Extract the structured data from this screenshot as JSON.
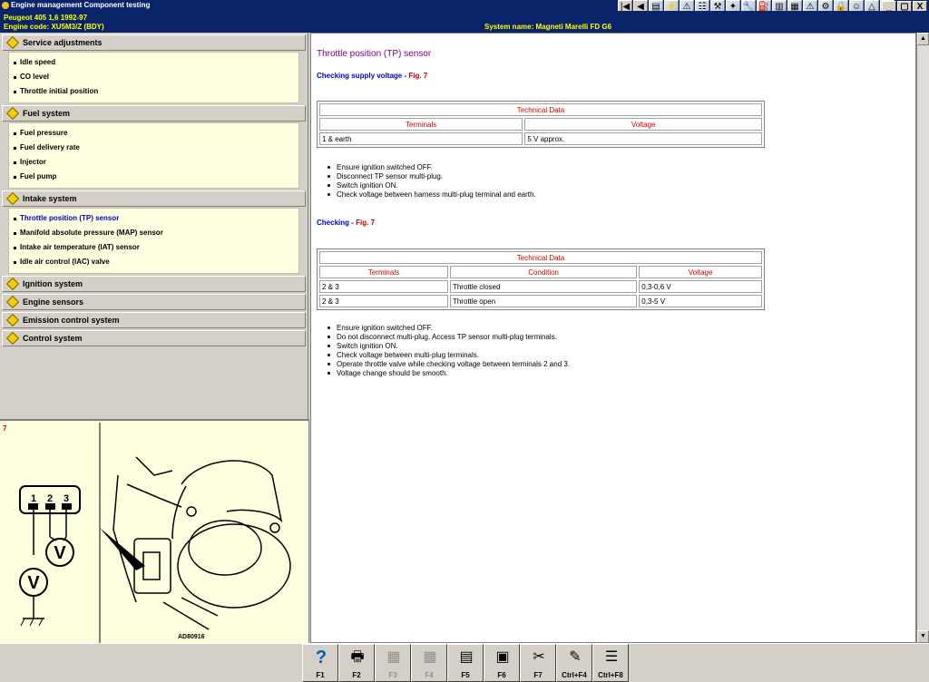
{
  "window": {
    "title": "Engine management Component testing"
  },
  "toolbar": {
    "buttons": [
      "first-icon",
      "prev-icon",
      "data-icon",
      "wiring-icon",
      "fault-icon",
      "service-icon",
      "tools-icon",
      "spark-icon",
      "wrench-icon",
      "oil-icon",
      "book-icon",
      "chart-icon",
      "warning-icon",
      "gear-icon",
      "lock-icon",
      "user-icon",
      "triangle-icon",
      "help-icon"
    ],
    "window_buttons": [
      "_",
      "▢",
      "X"
    ]
  },
  "vehicle": {
    "line1": "Peugeot   405 1,6   1992-97",
    "line2": "Engine code: XU5M3/Z (BDY)",
    "system": "System name: Magneti Marelli FD G6"
  },
  "nav": {
    "sections": [
      {
        "label": "Service adjustments",
        "items": [
          "Idle speed",
          "CO level",
          "Throttle initial position"
        ]
      },
      {
        "label": "Fuel system",
        "items": [
          "Fuel pressure",
          "Fuel delivery rate",
          "Injector",
          "Fuel pump"
        ]
      },
      {
        "label": "Intake system",
        "items": [
          "Throttle position (TP) sensor",
          "Manifold absolute pressure (MAP) sensor",
          "Intake air temperature (IAT) sensor",
          "Idle air control (IAC) valve"
        ]
      },
      {
        "label": "Ignition system",
        "items": []
      },
      {
        "label": "Engine sensors",
        "items": []
      },
      {
        "label": "Emission control system",
        "items": []
      },
      {
        "label": "Control system",
        "items": []
      }
    ],
    "active_item": "Throttle position (TP) sensor"
  },
  "figure": {
    "number": "7",
    "code": "AD80916",
    "pins": [
      "1",
      "2",
      "3"
    ],
    "meter": "V"
  },
  "content": {
    "title": "Throttle position (TP) sensor",
    "check1": {
      "text": "Checking supply voltage - ",
      "fig": "Fig. 7"
    },
    "table1": {
      "caption": "Technical Data",
      "headers": [
        "Terminals",
        "Voltage"
      ],
      "rows": [
        [
          "1 & earth",
          "5 V approx."
        ]
      ]
    },
    "steps1": [
      "Ensure ignition switched OFF.",
      "Disconnect TP sensor multi-plug.",
      "Switch ignition ON.",
      "Check voltage between harness multi-plug terminal and earth."
    ],
    "check2": {
      "text": "Checking - ",
      "fig": "Fig. 7"
    },
    "table2": {
      "caption": "Technical Data",
      "headers": [
        "Terminals",
        "Condition",
        "Voltage"
      ],
      "rows": [
        [
          "2 & 3",
          "Throttle closed",
          "0,3-0,6 V"
        ],
        [
          "2 & 3",
          "Throttle open",
          "0,3-5 V"
        ]
      ]
    },
    "steps2": [
      "Ensure ignition switched OFF.",
      "Do not disconnect multi-plug. Access TP sensor multi-plug terminals.",
      "Switch ignition ON.",
      "Check voltage between multi-plug terminals.",
      "Operate throttle valve while checking voltage between terminals 2 and 3.",
      "Voltage change should be smooth."
    ]
  },
  "fkeys": [
    {
      "label": "F1",
      "icon": "help-icon",
      "glyph": "?",
      "enabled": true
    },
    {
      "label": "F2",
      "icon": "print-icon",
      "glyph": "🖶",
      "enabled": true
    },
    {
      "label": "F3",
      "icon": "copy-icon",
      "glyph": "▦",
      "enabled": false
    },
    {
      "label": "F4",
      "icon": "paste-icon",
      "glyph": "▦",
      "enabled": false
    },
    {
      "label": "F5",
      "icon": "document-icon",
      "glyph": "▤",
      "enabled": true
    },
    {
      "label": "F6",
      "icon": "component-icon",
      "glyph": "▣",
      "enabled": true
    },
    {
      "label": "F7",
      "icon": "tools-icon",
      "glyph": "✂",
      "enabled": true
    },
    {
      "label": "Ctrl+F4",
      "icon": "note-icon",
      "glyph": "✎",
      "enabled": true
    },
    {
      "label": "Ctrl+F8",
      "icon": "list-icon",
      "glyph": "☰",
      "enabled": true
    }
  ]
}
